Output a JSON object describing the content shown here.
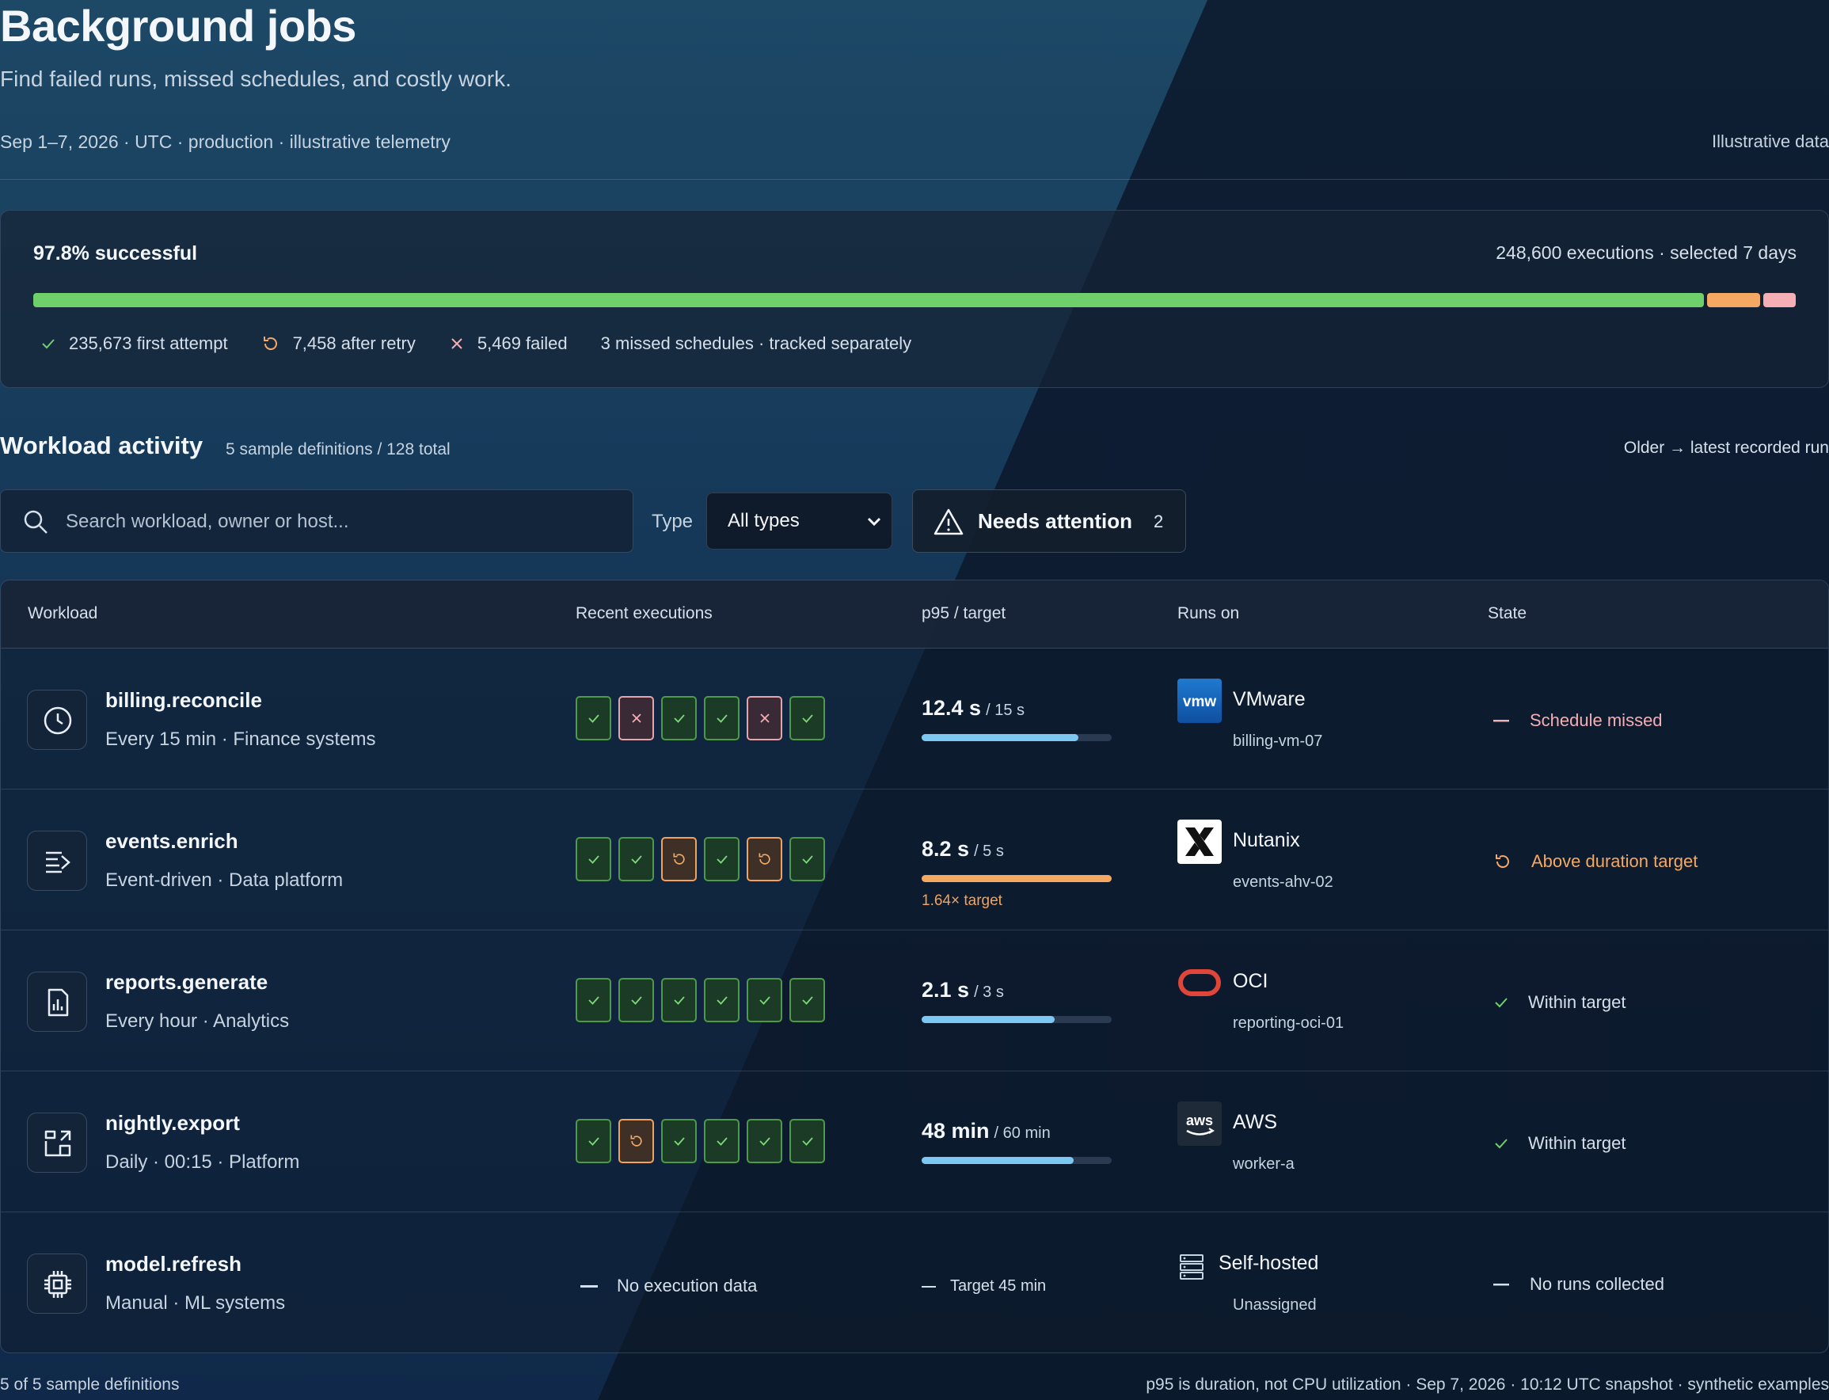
{
  "header": {
    "title": "Background jobs",
    "subtitle": "Find failed runs, missed schedules, and costly work.",
    "meta": "Sep 1–7, 2026 · UTC · production · illustrative telemetry",
    "meta_right": "Illustrative data"
  },
  "summary": {
    "success_pct": "97.8% successful",
    "executions": "248,600 executions · selected 7 days",
    "bar_fractions": {
      "first_attempt": 0.948,
      "after_retry": 0.03,
      "failed": 0.022
    },
    "colors": {
      "first_attempt": "#6fcf6a",
      "after_retry": "#f5a862",
      "failed": "#f4aeb4"
    },
    "legend": {
      "first_attempt": "235,673 first attempt",
      "after_retry": "7,458 after retry",
      "failed": "5,469 failed",
      "missed": "3 missed schedules · tracked separately"
    }
  },
  "activity": {
    "title": "Workload activity",
    "subtitle": "5 sample definitions / 128 total",
    "right_note": "Older → latest recorded run"
  },
  "filters": {
    "search_placeholder": "Search workload, owner or host...",
    "type_label": "Type",
    "type_value": "All types",
    "attention_label": "Needs attention",
    "attention_count": "2"
  },
  "table": {
    "headers": {
      "workload": "Workload",
      "recent": "Recent executions",
      "p95": "p95 / target",
      "runs_on": "Runs on",
      "state": "State"
    },
    "rows": [
      {
        "name": "billing.reconcile",
        "sub": "Every 15 min · Finance systems",
        "icon": "clock-icon",
        "execs": [
          "ok",
          "fail",
          "ok",
          "ok",
          "fail",
          "ok"
        ],
        "p95": "12.4 s",
        "target": "/ 15 s",
        "p95_fraction": 0.827,
        "bar_color": "#7cc8f3",
        "note": "",
        "host": "VMware",
        "host_sub": "billing-vm-07",
        "logo": "vmware-logo",
        "state": "Schedule missed",
        "state_color": "#f4aeb4",
        "state_icon": "dash-icon"
      },
      {
        "name": "events.enrich",
        "sub": "Event-driven · Data platform",
        "icon": "stream-icon",
        "execs": [
          "ok",
          "ok",
          "retry",
          "ok",
          "retry",
          "ok"
        ],
        "p95": "8.2 s",
        "target": "/ 5 s",
        "p95_fraction": 1.0,
        "bar_color": "#f5a862",
        "note": "1.64× target",
        "host": "Nutanix",
        "host_sub": "events-ahv-02",
        "logo": "nutanix-logo",
        "state": "Above duration target",
        "state_color": "#f5a862",
        "state_icon": "retry-icon"
      },
      {
        "name": "reports.generate",
        "sub": "Every hour · Analytics",
        "icon": "report-icon",
        "execs": [
          "ok",
          "ok",
          "ok",
          "ok",
          "ok",
          "ok"
        ],
        "p95": "2.1 s",
        "target": "/ 3 s",
        "p95_fraction": 0.7,
        "bar_color": "#7cc8f3",
        "note": "",
        "host": "OCI",
        "host_sub": "reporting-oci-01",
        "logo": "oci-logo",
        "state": "Within target",
        "state_color": "#d6e0ea",
        "state_icon": "check-icon"
      },
      {
        "name": "nightly.export",
        "sub": "Daily · 00:15 · Platform",
        "icon": "export-icon",
        "execs": [
          "ok",
          "retry",
          "ok",
          "ok",
          "ok",
          "ok"
        ],
        "p95": "48 min",
        "target": "/ 60 min",
        "p95_fraction": 0.8,
        "bar_color": "#7cc8f3",
        "note": "",
        "host": "AWS",
        "host_sub": "worker-a",
        "logo": "aws-logo",
        "state": "Within target",
        "state_color": "#d6e0ea",
        "state_icon": "check-icon"
      },
      {
        "name": "model.refresh",
        "sub": "Manual · ML systems",
        "icon": "chip-icon",
        "execs": [],
        "no_exec": "No execution data",
        "no_target": "Target 45 min",
        "host": "Self-hosted",
        "host_sub": "Unassigned",
        "logo": "server-icon",
        "state": "No runs collected",
        "state_color": "#d6e0ea",
        "state_icon": "dash-icon"
      }
    ]
  },
  "footer": {
    "left": "5 of 5 sample definitions",
    "right": "p95 is duration, not CPU utilization · Sep 7, 2026 · 10:12 UTC snapshot · synthetic examples"
  }
}
